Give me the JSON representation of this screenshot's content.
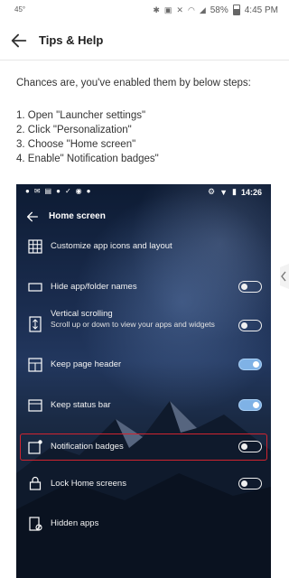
{
  "status_bar": {
    "left_text": "45°",
    "battery_percent": "58%",
    "time": "4:45 PM"
  },
  "app_bar": {
    "title": "Tips & Help",
    "back_icon": "arrow-left-icon"
  },
  "content": {
    "intro": "Chances are, you've enabled them by below steps:",
    "steps": [
      "1. Open \"Launcher settings\"",
      "2. Click \"Personalization\"",
      "3. Choose \"Home screen\"",
      "4. Enable\" Notification badges\""
    ]
  },
  "embedded_screenshot": {
    "status_time": "14:26",
    "header_title": "Home screen",
    "items": [
      {
        "label": "Customize app icons and layout",
        "icon": "grid-icon"
      },
      {
        "label": "Hide app/folder names",
        "icon": "label-icon",
        "toggle": "off"
      },
      {
        "label": "Vertical scrolling",
        "sublabel": "Scroll up or down to view your apps and widgets",
        "icon": "vertical-scroll-icon",
        "toggle": "off"
      },
      {
        "label": "Keep page header",
        "icon": "page-header-icon",
        "toggle": "on"
      },
      {
        "label": "Keep status bar",
        "icon": "status-bar-icon",
        "toggle": "on"
      },
      {
        "label": "Notification badges",
        "icon": "notification-badge-icon",
        "toggle": "off",
        "highlighted": true
      },
      {
        "label": "Lock Home screens",
        "icon": "lock-icon",
        "toggle": "off"
      },
      {
        "label": "Hidden apps",
        "icon": "hidden-apps-icon"
      }
    ],
    "toggle_on_color": "#7fb2e6",
    "highlight_color": "#d0242f"
  }
}
